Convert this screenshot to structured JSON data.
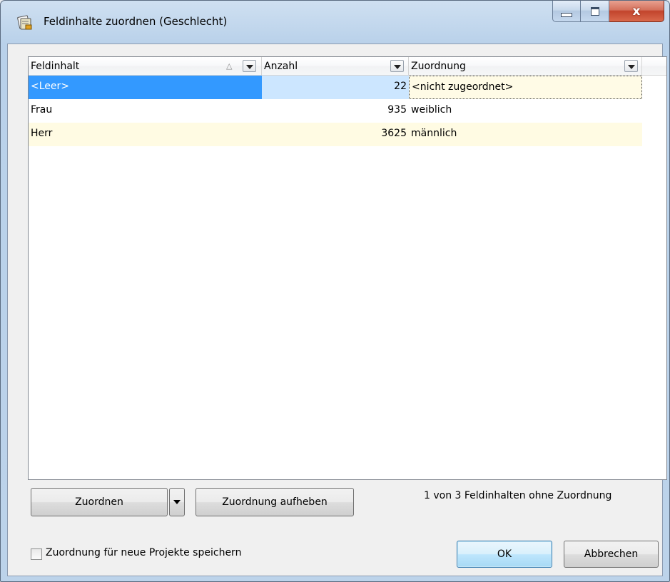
{
  "window": {
    "title": "Feldinhalte zuordnen (Geschlecht)",
    "close_glyph": "x"
  },
  "grid": {
    "columns": [
      {
        "label": "Feldinhalt",
        "sort": "ascending",
        "sort_glyph": "△"
      },
      {
        "label": "Anzahl"
      },
      {
        "label": "Zuordnung"
      }
    ],
    "rows": [
      {
        "feldinhalt": "<Leer>",
        "anzahl": "22",
        "zuordnung": "<nicht zugeordnet>",
        "state": "selected"
      },
      {
        "feldinhalt": "Frau",
        "anzahl": "935",
        "zuordnung": "weiblich",
        "state": "normal"
      },
      {
        "feldinhalt": "Herr",
        "anzahl": "3625",
        "zuordnung": "männlich",
        "state": "alternate"
      }
    ]
  },
  "buttons": {
    "assign": "Zuordnen",
    "unassign": "Zuordnung aufheben",
    "ok": "OK",
    "cancel": "Abbrechen"
  },
  "status": "1 von 3 Feldinhalten ohne Zuordnung",
  "save_option": {
    "label": "Zuordnung für neue Projekte speichern",
    "checked": false
  },
  "colors": {
    "selection": "#3399ff",
    "row_highlight": "#fffbe3",
    "close_button": "#c2442c"
  },
  "icons": {
    "app": "app-form-icon",
    "minimize": "minimize-icon",
    "maximize": "maximize-icon",
    "close": "close-icon",
    "sort": "sort-ascending-icon",
    "dropdown": "chevron-down-icon"
  }
}
